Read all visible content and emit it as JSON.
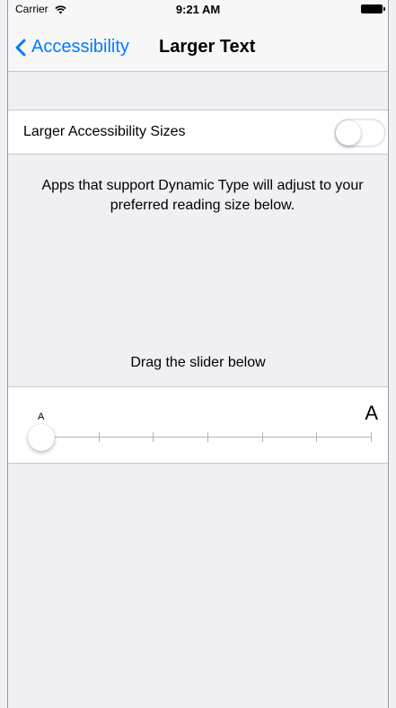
{
  "status_bar": {
    "carrier": "Carrier",
    "time": "9:21 AM"
  },
  "nav": {
    "back_label": "Accessibility",
    "title": "Larger Text"
  },
  "toggle": {
    "label": "Larger Accessibility Sizes",
    "on": false
  },
  "description": "Apps that support Dynamic Type will adjust to your preferred reading size below.",
  "slider": {
    "hint": "Drag the slider below",
    "small_label": "A",
    "large_label": "A",
    "steps": 7,
    "selected_step": 1
  },
  "colors": {
    "accent": "#007aff",
    "background": "#efeff4"
  },
  "icons": [
    "wifi-icon",
    "battery-icon",
    "chevron-left-icon"
  ]
}
